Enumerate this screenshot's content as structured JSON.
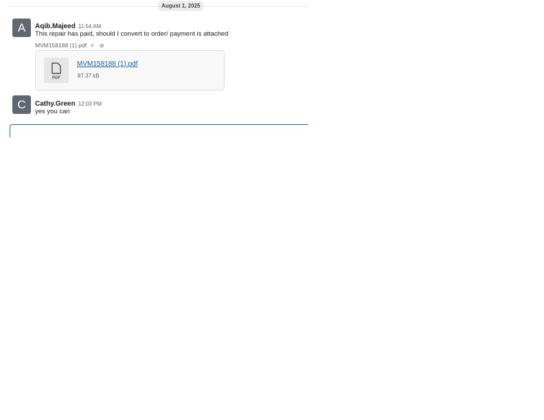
{
  "date_divider": "August 1, 2025",
  "messages": [
    {
      "avatar": "A",
      "sender": "Aqib.Majeed",
      "time": "11:54 AM",
      "text": "This repair has paid, should I convert to order/ payment is attached",
      "file_line": "MVM158188 (1).pdf",
      "attachment": {
        "name": "MVM158188 (1).pdf",
        "ext": "PDF",
        "size": "87.37 kB",
        "icon": "file-icon"
      }
    },
    {
      "avatar": "C",
      "sender": "Cathy.Green",
      "time": "12:03 PM",
      "text": "yes you can"
    }
  ],
  "colors": {
    "link": "#1264a3",
    "avatar_bg": "#616670",
    "composer_border": "#1264a3"
  }
}
